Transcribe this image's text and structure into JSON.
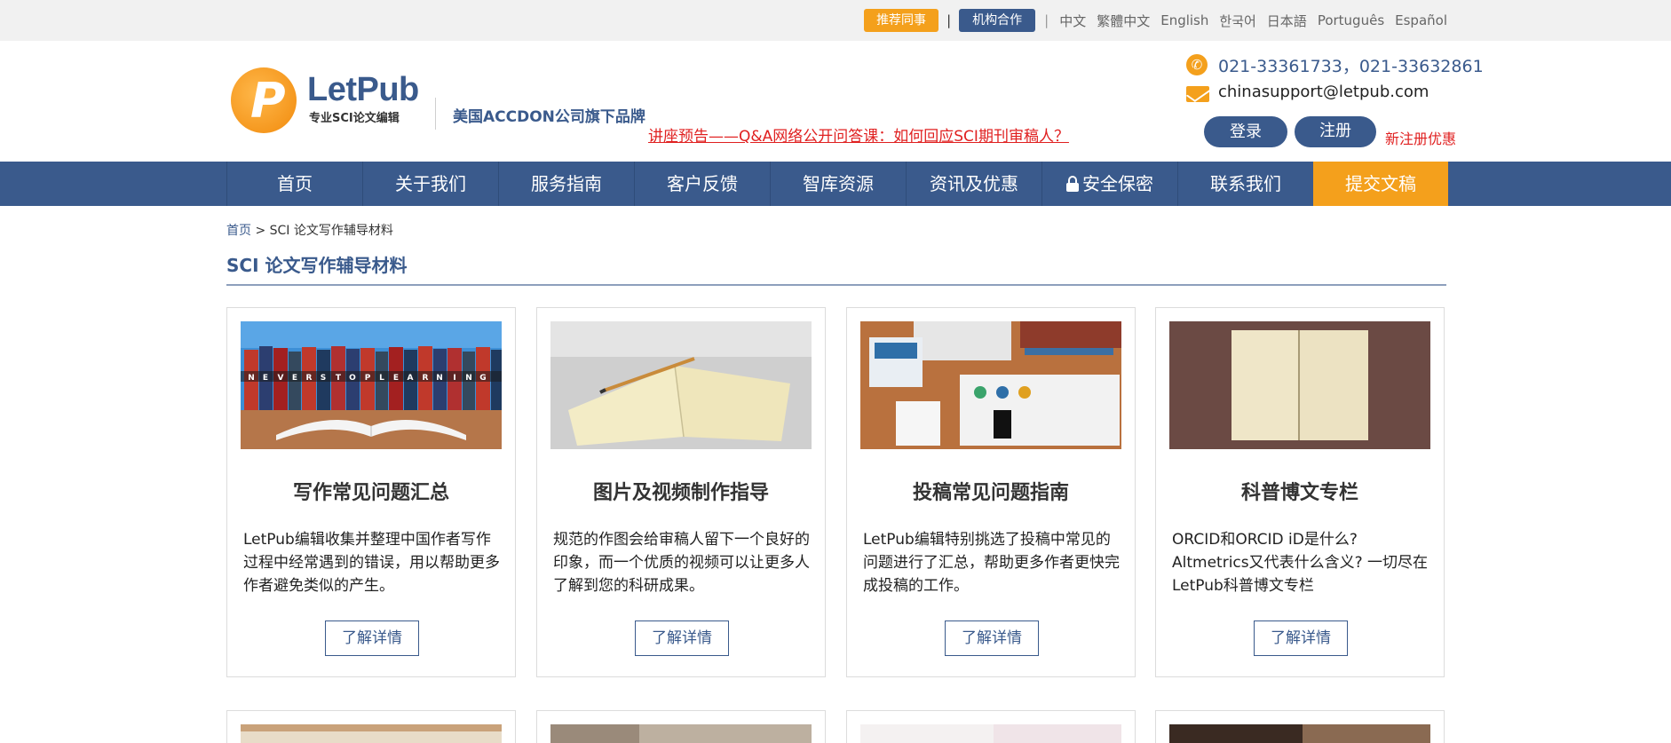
{
  "topbar": {
    "recommend": "推荐同事",
    "separator": "|",
    "partner": "机构合作",
    "languages": [
      "中文",
      "繁體中文",
      "English",
      "한국어",
      "日本語",
      "Português",
      "Español"
    ]
  },
  "header": {
    "logo_letter": "P",
    "brand_name": "LetPub",
    "brand_sub": "专业SCI论文编辑",
    "slogan": "美国ACCDON公司旗下品牌",
    "lecture": "讲座预告——Q&A网络公开问答课：如何回应SCI期刊审稿人？",
    "phone_icon": "phone-icon",
    "phone": "021-33361733，021-33632861",
    "mail_icon": "mail-icon",
    "email": "chinasupport@letpub.com",
    "login": "登录",
    "register": "注册",
    "promo": "新注册优惠"
  },
  "nav": {
    "items": [
      "首页",
      "关于我们",
      "服务指南",
      "客户反馈",
      "智库资源",
      "资讯及优惠",
      "安全保密",
      "联系我们",
      "提交文稿"
    ]
  },
  "breadcrumb": {
    "home": "首页",
    "current": "> SCI 论文写作辅导材料"
  },
  "page_title": "SCI 论文写作辅导材料",
  "cards": [
    {
      "title": "写作常见问题汇总",
      "desc": "LetPub编辑收集并整理中国作者写作过程中经常遇到的错误，用以帮助更多作者避免类似的产生。",
      "button": "了解详情",
      "image_text": "NEVER STOP LEARNING"
    },
    {
      "title": "图片及视频制作指导",
      "desc": "规范的作图会给审稿人留下一个良好的印象，而一个优质的视频可以让更多人了解到您的科研成果。",
      "button": "了解详情"
    },
    {
      "title": "投稿常见问题指南",
      "desc": "LetPub编辑特别挑选了投稿中常见的问题进行了汇总，帮助更多作者更快完成投稿的工作。",
      "button": "了解详情"
    },
    {
      "title": "科普博文专栏",
      "desc": "ORCID和ORCID iD是什么? Altmetrics又代表什么含义? 一切尽在LetPub科普博文专栏",
      "button": "了解详情"
    }
  ],
  "colors": {
    "brand_blue": "#3a5a8c",
    "accent_orange": "#f4a01c",
    "alert_red": "#e02020"
  }
}
